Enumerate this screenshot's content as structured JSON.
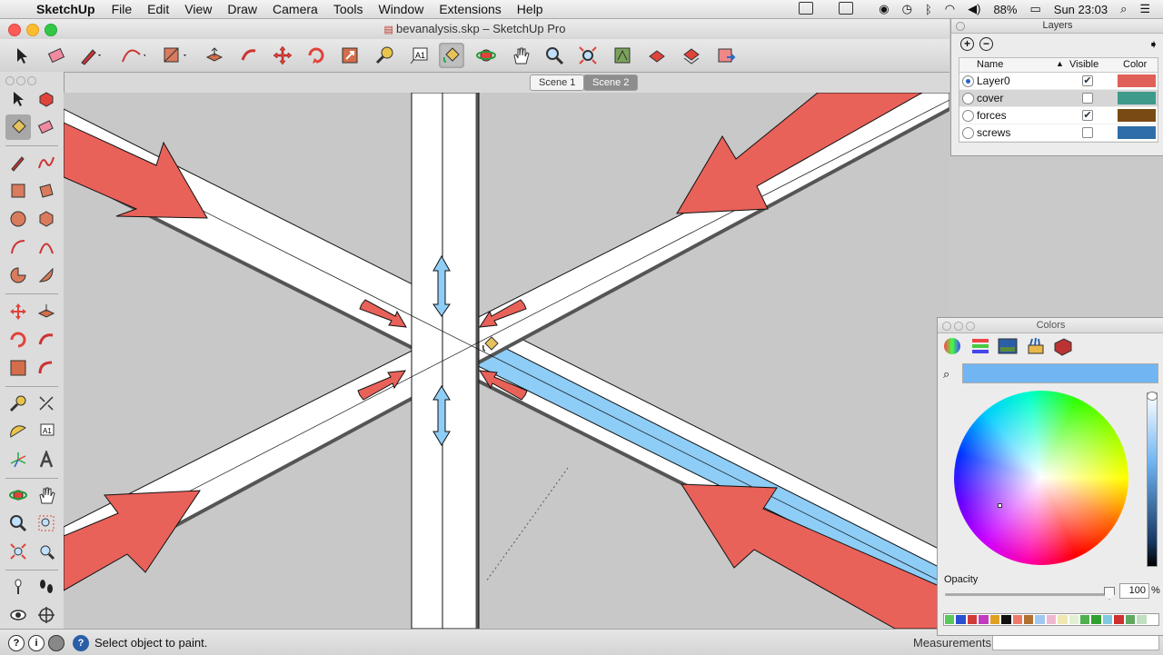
{
  "menubar": {
    "app": "SketchUp",
    "items": [
      "File",
      "Edit",
      "View",
      "Draw",
      "Camera",
      "Tools",
      "Window",
      "Extensions",
      "Help"
    ],
    "battery": "88%",
    "clock": "Sun 23:03"
  },
  "window": {
    "title": "bevanalysis.skp – SketchUp Pro"
  },
  "scenes": [
    {
      "label": "Scene 1",
      "active": false
    },
    {
      "label": "Scene 2",
      "active": true
    }
  ],
  "statusbar": {
    "hint": "Select object to paint.",
    "measurements_label": "Measurements",
    "measurements_value": ""
  },
  "layers_panel": {
    "title": "Layers",
    "columns": {
      "name": "Name",
      "visible": "Visible",
      "color": "Color"
    },
    "rows": [
      {
        "name": "Layer0",
        "current": true,
        "visible": true,
        "color": "#e05f58"
      },
      {
        "name": "cover",
        "current": false,
        "visible": false,
        "color": "#3f9a8b"
      },
      {
        "name": "forces",
        "current": false,
        "visible": true,
        "color": "#7a4a14"
      },
      {
        "name": "screws",
        "current": false,
        "visible": false,
        "color": "#2f6da8"
      }
    ]
  },
  "colors_panel": {
    "title": "Colors",
    "current_color": "#72b5f3",
    "opacity_label": "Opacity",
    "opacity_value": "100",
    "opacity_unit": "%",
    "swatches": [
      "#5ac85a",
      "#2a4fd0",
      "#d13a3a",
      "#c23ac2",
      "#e0a020",
      "#111111",
      "#f07a6a",
      "#b07030",
      "#a0c8f0",
      "#f0b8d0",
      "#f0e8b0",
      "#e0f0d0",
      "#50b050",
      "#30a030",
      "#80c8e0",
      "#d03030",
      "#60a860",
      "#c0e0c0",
      "#ffffff"
    ]
  },
  "colors": {
    "model_arrow": "#e8625a",
    "selected_face": "#8ecdf6",
    "beam": "#ffffff",
    "background": "#c8c8c8"
  }
}
